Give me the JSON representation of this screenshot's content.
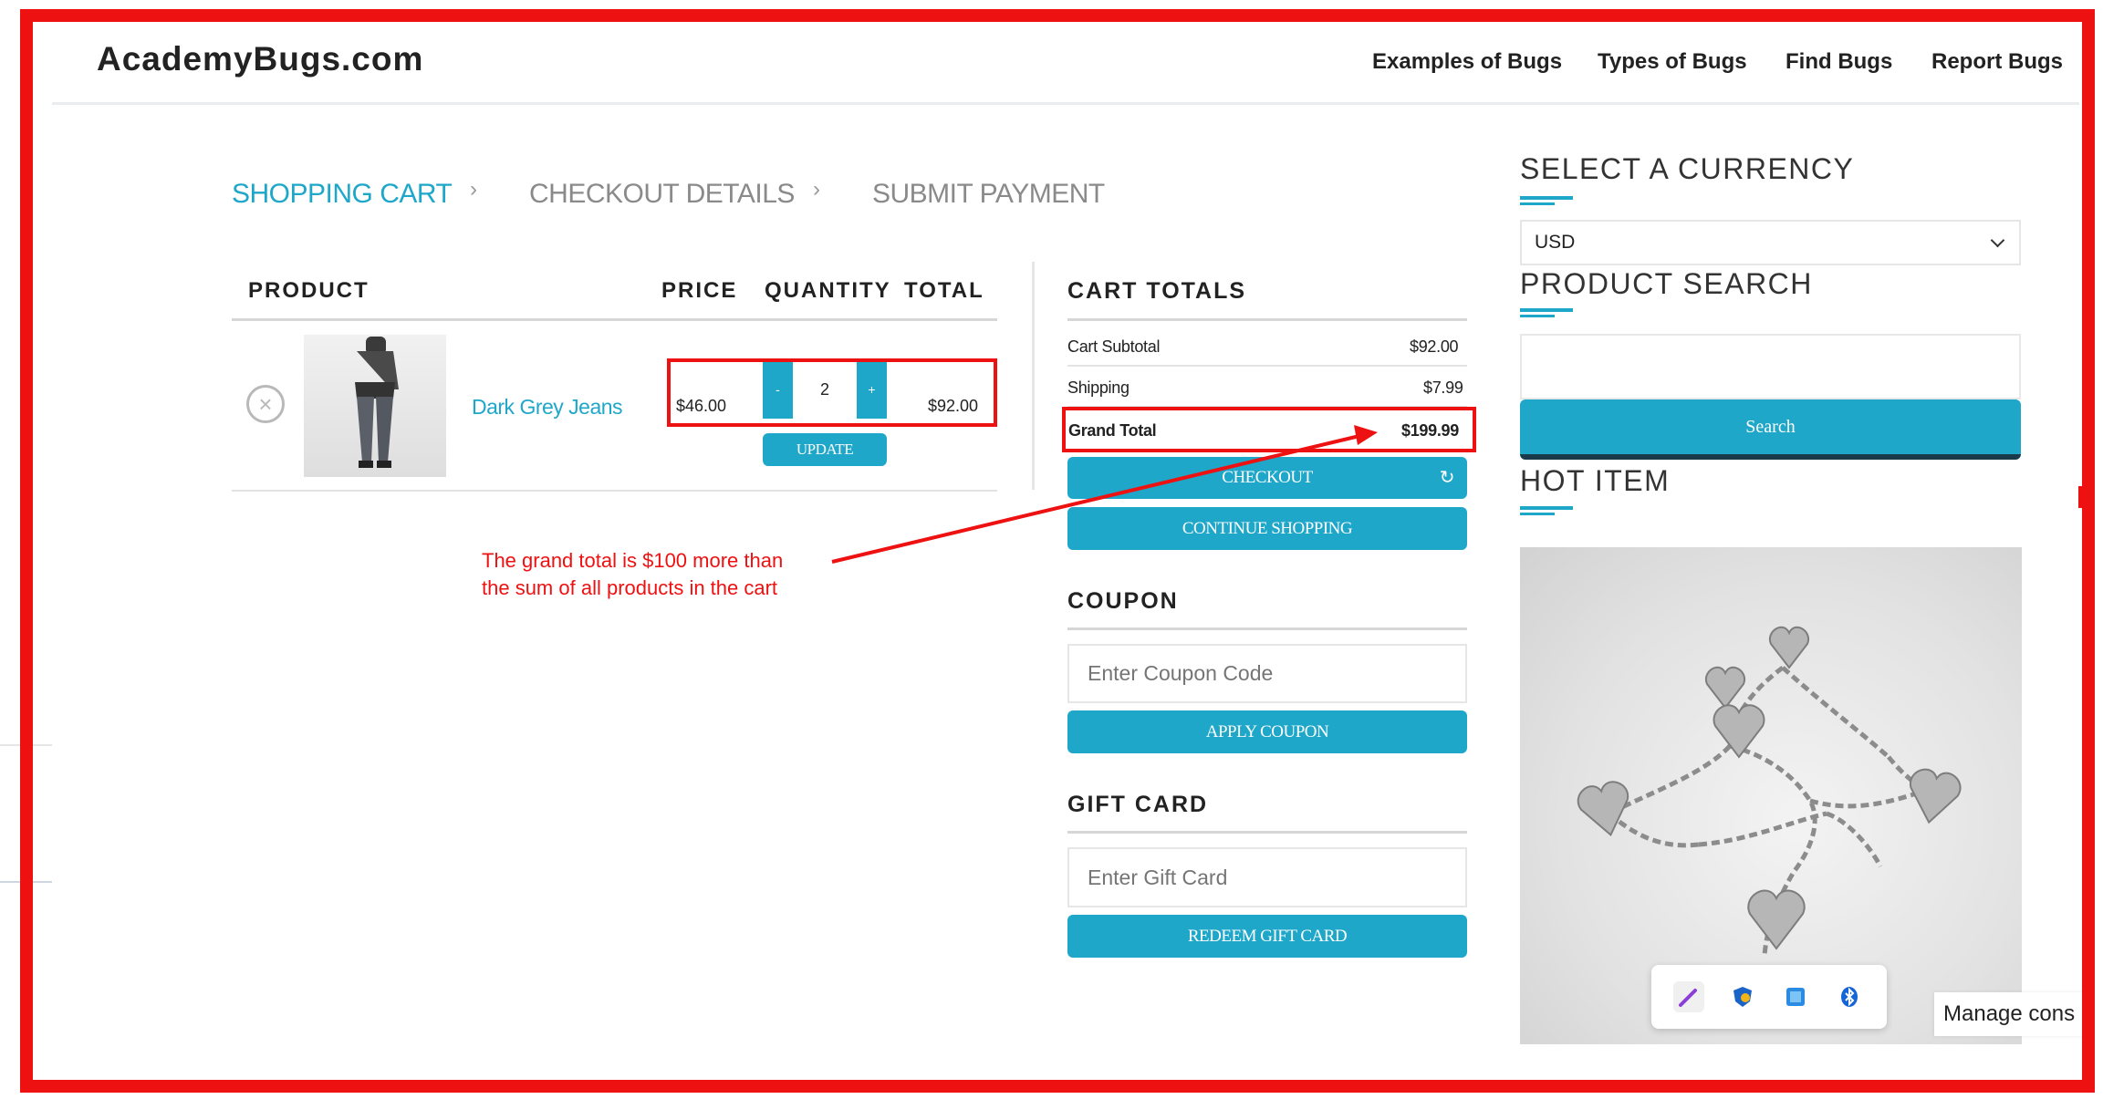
{
  "header": {
    "logo": "AcademyBugs.com",
    "nav": [
      "Examples of Bugs",
      "Types of Bugs",
      "Find Bugs",
      "Report Bugs"
    ]
  },
  "breadcrumb": {
    "steps": [
      "SHOPPING CART",
      "CHECKOUT DETAILS",
      "SUBMIT PAYMENT"
    ],
    "active_index": 0
  },
  "cart": {
    "columns": [
      "PRODUCT",
      "PRICE",
      "QUANTITY",
      "TOTAL"
    ],
    "item": {
      "name": "Dark Grey Jeans",
      "price": "$46.00",
      "quantity": "2",
      "total": "$92.00",
      "decrement_label": "-",
      "increment_label": "+"
    },
    "update_label": "UPDATE"
  },
  "cart_totals": {
    "title": "CART TOTALS",
    "rows": [
      {
        "label": "Cart Subtotal",
        "value": "$92.00"
      },
      {
        "label": "Shipping",
        "value": "$7.99"
      },
      {
        "label": "Grand Total",
        "value": "$199.99"
      }
    ],
    "checkout_label": "CHECKOUT",
    "continue_label": "CONTINUE SHOPPING"
  },
  "coupon": {
    "title": "COUPON",
    "placeholder": "Enter Coupon Code",
    "apply_label": "APPLY COUPON"
  },
  "gift_card": {
    "title": "GIFT CARD",
    "placeholder": "Enter Gift Card",
    "redeem_label": "REDEEM GIFT CARD"
  },
  "sidebar": {
    "currency_title": "SELECT A CURRENCY",
    "currency_value": "USD",
    "search_title": "PRODUCT SEARCH",
    "search_button": "Search",
    "hot_item_title": "HOT ITEM"
  },
  "annotation": {
    "line1": "The grand total is $100 more than",
    "line2": "the sum of all products in the cart"
  },
  "consent": {
    "label": "Manage cons"
  },
  "colors": {
    "accent": "#1ea7c9",
    "annotation_red": "#ee1111",
    "divider": "#d6d6d6"
  },
  "icons": [
    "remove-icon",
    "chevron-down-icon",
    "refresh-icon",
    "pen-icon",
    "shield-icon",
    "photo-icon",
    "bluetooth-icon"
  ]
}
